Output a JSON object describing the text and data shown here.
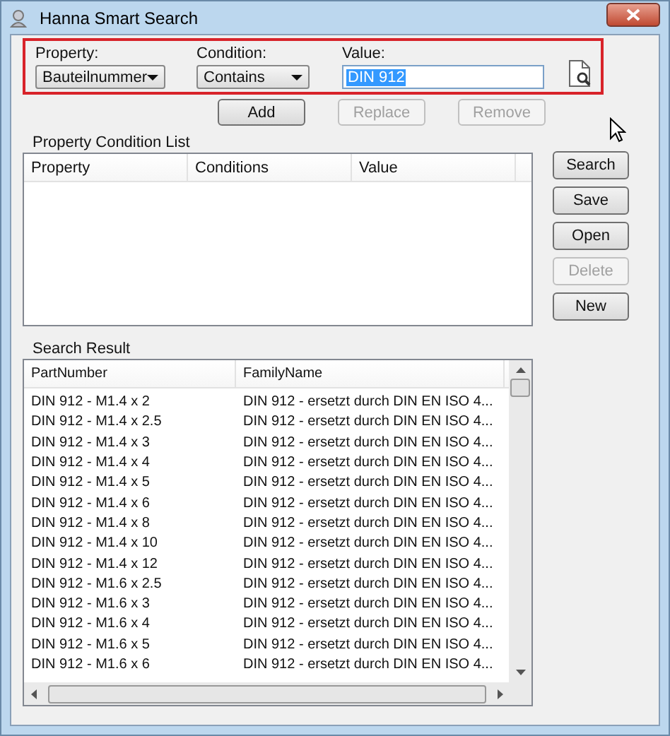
{
  "window": {
    "title": "Hanna Smart Search"
  },
  "criteria": {
    "property_label": "Property:",
    "property_value": "Bauteilnummer",
    "condition_label": "Condition:",
    "condition_value": "Contains",
    "value_label": "Value:",
    "value": "DIN 912"
  },
  "action_buttons": [
    {
      "label": "Add",
      "disabled": false
    },
    {
      "label": "Replace",
      "disabled": true
    },
    {
      "label": "Remove",
      "disabled": true
    }
  ],
  "condition_list": {
    "title": "Property Condition List",
    "columns": [
      "Property",
      "Conditions",
      "Value"
    ]
  },
  "side_buttons": [
    {
      "label": "Search",
      "disabled": false
    },
    {
      "label": "Save",
      "disabled": false
    },
    {
      "label": "Open",
      "disabled": false
    },
    {
      "label": "Delete",
      "disabled": true
    },
    {
      "label": "New",
      "disabled": false
    }
  ],
  "search_result": {
    "title": "Search Result",
    "columns": [
      "PartNumber",
      "FamilyName"
    ],
    "rows": [
      [
        "DIN 912 - M1.4 x 2",
        "DIN 912 - ersetzt durch DIN EN ISO 4..."
      ],
      [
        "DIN 912 - M1.4 x 2.5",
        "DIN 912 - ersetzt durch DIN EN ISO 4..."
      ],
      [
        "DIN 912 - M1.4 x 3",
        "DIN 912 - ersetzt durch DIN EN ISO 4..."
      ],
      [
        "DIN 912 - M1.4 x 4",
        "DIN 912 - ersetzt durch DIN EN ISO 4..."
      ],
      [
        "DIN 912 - M1.4 x 5",
        "DIN 912 - ersetzt durch DIN EN ISO 4..."
      ],
      [
        "DIN 912 - M1.4 x 6",
        "DIN 912 - ersetzt durch DIN EN ISO 4..."
      ],
      [
        "DIN 912 - M1.4 x 8",
        "DIN 912 - ersetzt durch DIN EN ISO 4..."
      ],
      [
        "DIN 912 - M1.4 x 10",
        "DIN 912 - ersetzt durch DIN EN ISO 4..."
      ],
      [
        "DIN 912 - M1.4 x 12",
        "DIN 912 - ersetzt durch DIN EN ISO 4..."
      ],
      [
        "DIN 912 - M1.6 x 2.5",
        "DIN 912 - ersetzt durch DIN EN ISO 4..."
      ],
      [
        "DIN 912 - M1.6 x 3",
        "DIN 912 - ersetzt durch DIN EN ISO 4..."
      ],
      [
        "DIN 912 - M1.6 x 4",
        "DIN 912 - ersetzt durch DIN EN ISO 4..."
      ],
      [
        "DIN 912 - M1.6 x 5",
        "DIN 912 - ersetzt durch DIN EN ISO 4..."
      ],
      [
        "DIN 912 - M1.6 x 6",
        "DIN 912 - ersetzt durch DIN EN ISO 4..."
      ]
    ]
  }
}
